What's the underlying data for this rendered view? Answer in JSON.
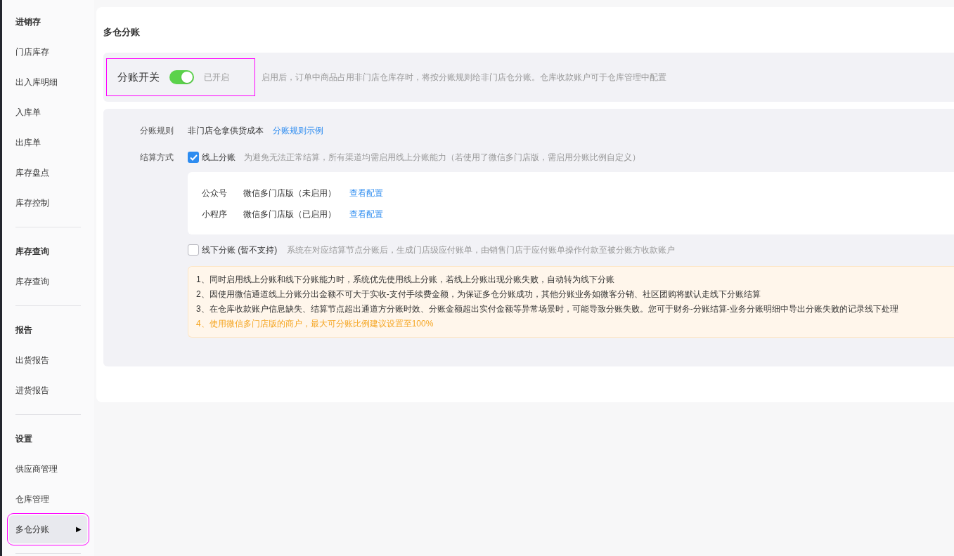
{
  "sidebar": {
    "groups": [
      {
        "title": "进销存",
        "items": [
          {
            "label": "门店库存",
            "selected": false
          },
          {
            "label": "出入库明细",
            "selected": false
          },
          {
            "label": "入库单",
            "selected": false
          },
          {
            "label": "出库单",
            "selected": false
          },
          {
            "label": "库存盘点",
            "selected": false
          },
          {
            "label": "库存控制",
            "selected": false
          }
        ]
      },
      {
        "title": "库存查询",
        "items": [
          {
            "label": "库存查询",
            "selected": false
          }
        ]
      },
      {
        "title": "报告",
        "items": [
          {
            "label": "出货报告",
            "selected": false
          },
          {
            "label": "进货报告",
            "selected": false
          }
        ]
      },
      {
        "title": "设置",
        "items": [
          {
            "label": "供应商管理",
            "selected": false
          },
          {
            "label": "仓库管理",
            "selected": false
          },
          {
            "label": "多仓分账",
            "selected": true,
            "highlighted": true,
            "arrow": "▶"
          }
        ]
      }
    ]
  },
  "page": {
    "title": "多仓分账",
    "switch": {
      "label": "分账开关",
      "on": true,
      "status": "已开启",
      "highlighted": true,
      "description": "启用后，订单中商品占用非门店仓库存时，将按分账规则给非门店仓分账。仓库收款账户可于仓库管理中配置"
    },
    "rule": {
      "label": "分账规则",
      "value": "非门店仓拿供货成本",
      "link": "分账规则示例"
    },
    "settlement": {
      "label": "结算方式",
      "online": {
        "label": "线上分账",
        "checked": true,
        "hint": "为避免无法正常结算，所有渠道均需启用线上分账能力（若使用了微信多门店版，需启用分账比例自定义）",
        "channels": [
          {
            "name": "公众号",
            "status": "微信多门店版（未启用）",
            "link": "查看配置"
          },
          {
            "name": "小程序",
            "status": "微信多门店版（已启用）",
            "link": "查看配置"
          }
        ]
      },
      "offline": {
        "label": "线下分账 (暂不支持)",
        "checked": false,
        "hint": "系统在对应结算节点分账后，生成门店级应付账单，由销售门店于应付账单操作付款至被分账方收款账户"
      }
    },
    "notes": [
      {
        "text": "1、同时启用线上分账和线下分账能力时，系统优先使用线上分账，若线上分账出现分账失败，自动转为线下分账",
        "kind": "normal"
      },
      {
        "text": "2、因使用微信通道线上分账分出金额不可大于实收-支付手续费金额，为保证多仓分账成功，其他分账业务如微客分销、社区团购将默认走线下分账结算",
        "kind": "normal"
      },
      {
        "text": "3、在仓库收款账户信息缺失、结算节点超出通道方分账时效、分账金额超出实付金额等异常场景时，可能导致分账失败。您可于财务-分账结算-业务分账明细中导出分账失败的记录线下处理",
        "kind": "normal"
      },
      {
        "text": "4、使用微信多门店版的商户，最大可分账比例建议设置至100%",
        "kind": "warning"
      }
    ]
  }
}
